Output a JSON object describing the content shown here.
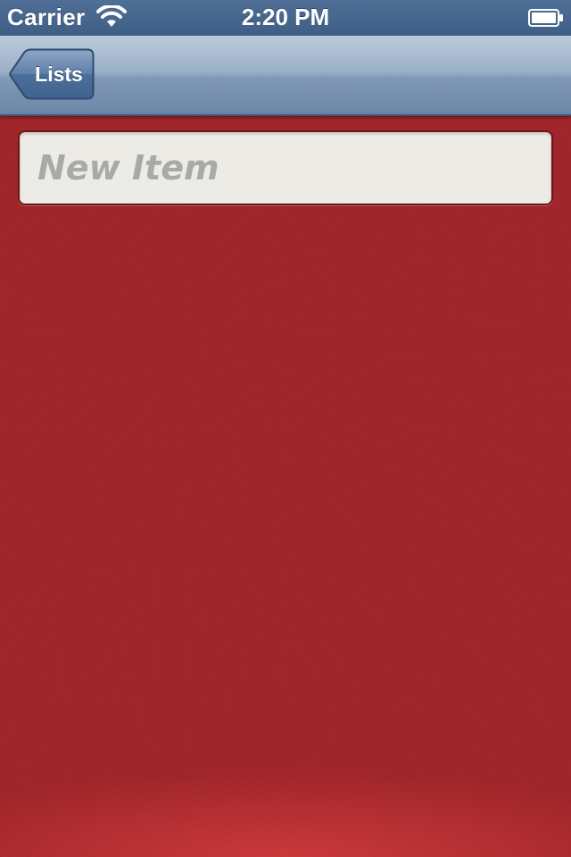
{
  "status_bar": {
    "carrier": "Carrier",
    "time": "2:20 PM",
    "wifi_icon": "wifi-icon",
    "battery_icon": "battery-icon"
  },
  "nav_bar": {
    "back_label": "Lists",
    "back_icon": "back-chevron-button"
  },
  "new_item": {
    "placeholder": "New Item",
    "value": ""
  },
  "colors": {
    "background_red": "#a1262a",
    "nav_blue": "#7f98b5",
    "field_bg": "#ecebe6",
    "placeholder_gray": "#a9a9a6"
  }
}
